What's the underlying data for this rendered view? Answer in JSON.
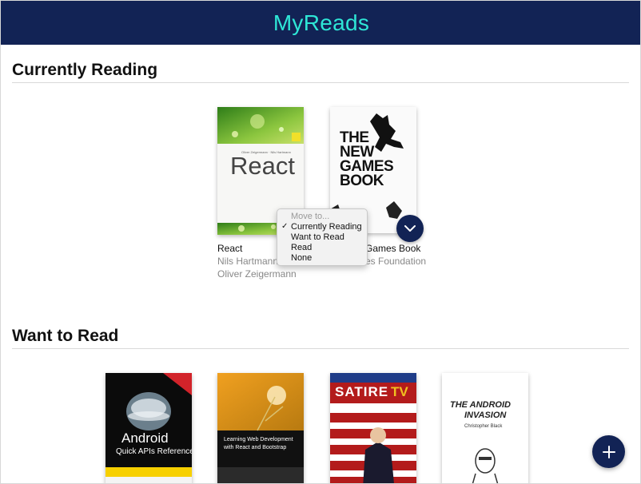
{
  "header": {
    "title": "MyReads"
  },
  "shelves": [
    {
      "title": "Currently Reading",
      "books": [
        {
          "title": "React",
          "authors": [
            "Nils Hartmann",
            "Oliver Zeigermann"
          ],
          "cover_text": "React",
          "cover_small": "Oliver Zeigermann · Nils Hartmann"
        },
        {
          "title": "The New Games Book",
          "title_visible": "Games Book",
          "authors": [
            "New Games Foundation"
          ],
          "authors_visible": [
            "es Foundation"
          ],
          "cover_text": [
            "THE",
            "NEW",
            "GAMES",
            "BOOK"
          ]
        }
      ]
    },
    {
      "title": "Want to Read",
      "books": [
        {
          "cover_title": "Android",
          "cover_sub": "Quick APIs Reference"
        },
        {
          "cover_title": "Learning Web Development",
          "cover_sub": "with React and Bootstrap"
        },
        {
          "cover_title": "SATIRE",
          "cover_tag": "TV"
        },
        {
          "cover_title": "THE ANDROID",
          "cover_title2": "INVASION",
          "cover_author": "Christopher Black"
        }
      ]
    }
  ],
  "menu": {
    "heading": "Move to...",
    "items": [
      "Currently Reading",
      "Want to Read",
      "Read",
      "None"
    ],
    "checked": "Currently Reading"
  },
  "fab": {
    "icon": "plus-icon",
    "symbol": "+"
  },
  "colors": {
    "header": "#122355",
    "title": "#2ee6d6",
    "button": "#122355"
  }
}
